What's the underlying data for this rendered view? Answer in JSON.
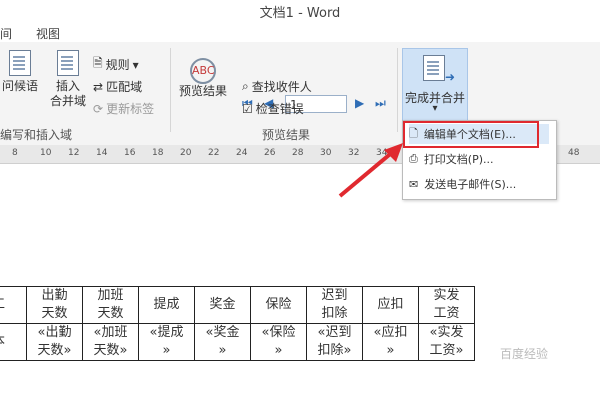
{
  "window": {
    "title": "文档1 - Word"
  },
  "tabs": [
    {
      "label": "间"
    },
    {
      "label": "视图"
    }
  ],
  "ribbon": {
    "group_write_insert": {
      "label": "编写和插入域",
      "greeting_line": "问候语",
      "insert_merge_field": [
        "插入",
        "合并域"
      ],
      "rules": "规则",
      "match_fields": "匹配域",
      "update_labels": "更新标签"
    },
    "group_preview": {
      "label": "预览结果",
      "preview_results": "预览结果",
      "record_number": "1",
      "find_recipient": "查找收件人",
      "check_errors": "检查错误"
    },
    "finish": {
      "label": "完成并合并"
    }
  },
  "menu": {
    "items": [
      {
        "label": "编辑单个文档(E)..."
      },
      {
        "label": "打印文档(P)..."
      },
      {
        "label": "发送电子邮件(S)..."
      }
    ]
  },
  "ruler": {
    "ticks": [
      "8",
      "10",
      "12",
      "14",
      "16",
      "18",
      "20",
      "22",
      "24",
      "26",
      "28",
      "30",
      "32",
      "34",
      "48"
    ]
  },
  "table": {
    "header": [
      [
        "工"
      ],
      [
        "出勤",
        "天数"
      ],
      [
        "加班",
        "天数"
      ],
      [
        "提成"
      ],
      [
        "奖金"
      ],
      [
        "保险"
      ],
      [
        "迟到",
        "扣除"
      ],
      [
        "应扣"
      ],
      [
        "实发",
        "工资"
      ]
    ],
    "fields": [
      [
        "本"
      ],
      [
        "«出勤",
        "天数»"
      ],
      [
        "«加班",
        "天数»"
      ],
      [
        "«提成",
        "»"
      ],
      [
        "«奖金",
        "»"
      ],
      [
        "«保险",
        "»"
      ],
      [
        "«迟到",
        "扣除»"
      ],
      [
        "«应扣",
        "»"
      ],
      [
        "«实发",
        "工资»"
      ]
    ]
  },
  "watermark": "百度经验",
  "colors": {
    "accent": "#2f6db5",
    "highlight": "#e0292f",
    "selected": "#cfe2f6"
  }
}
